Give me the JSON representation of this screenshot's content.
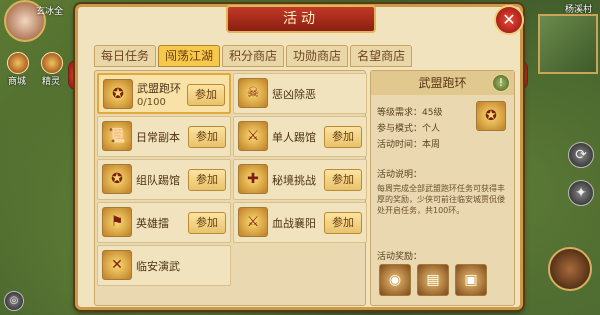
{
  "hud": {
    "player_name": "玄冰全",
    "left_buttons": [
      {
        "label": "商城",
        "icon": "shop-icon"
      },
      {
        "label": "精灵",
        "icon": "spirit-icon"
      }
    ],
    "map_name": "杨溪村"
  },
  "panel": {
    "title": "活动",
    "close_symbol": "✕",
    "tabs": [
      {
        "label": "每日任务",
        "active": false
      },
      {
        "label": "闯荡江湖",
        "active": true
      },
      {
        "label": "积分商店",
        "active": false
      },
      {
        "label": "功勋商店",
        "active": false
      },
      {
        "label": "名望商店",
        "active": false
      }
    ],
    "activities": [
      {
        "name": "武盟跑环",
        "progress": "0/100",
        "join_label": "参加",
        "selected": true,
        "icon": "alliance-emblem-icon"
      },
      {
        "name": "惩凶除恶",
        "progress": "",
        "join_label": "",
        "selected": false,
        "icon": "demon-mask-icon"
      },
      {
        "name": "日常副本",
        "progress": "",
        "join_label": "参加",
        "selected": false,
        "icon": "scroll-icon"
      },
      {
        "name": "单人踢馆",
        "progress": "",
        "join_label": "参加",
        "selected": false,
        "icon": "single-fighter-icon"
      },
      {
        "name": "组队踢馆",
        "progress": "",
        "join_label": "参加",
        "selected": false,
        "icon": "team-emblem-icon"
      },
      {
        "name": "秘境挑战",
        "progress": "",
        "join_label": "参加",
        "selected": false,
        "icon": "secret-realm-icon"
      },
      {
        "name": "英雄擂",
        "progress": "",
        "join_label": "参加",
        "selected": false,
        "icon": "arena-icon"
      },
      {
        "name": "血战襄阳",
        "progress": "",
        "join_label": "参加",
        "selected": false,
        "icon": "crossed-swords-icon"
      },
      {
        "name": "临安演武",
        "progress": "",
        "join_label": "",
        "selected": false,
        "icon": "crossed-spears-icon"
      }
    ],
    "detail": {
      "title": "武盟跑环",
      "info_symbol": "!",
      "level_req": "等级需求：45级",
      "mode": "参与模式：个人",
      "time": "活动时间：本周",
      "desc_label": "活动说明：",
      "desc": "每周完成全部武盟跑环任务可获得丰厚的奖励，少侠可前往临安城贾侃偻处开启任务，共100环。",
      "rewards_label": "活动奖励：",
      "rewards": [
        "coin-icon",
        "scroll-reward-icon",
        "chest-icon"
      ]
    }
  }
}
